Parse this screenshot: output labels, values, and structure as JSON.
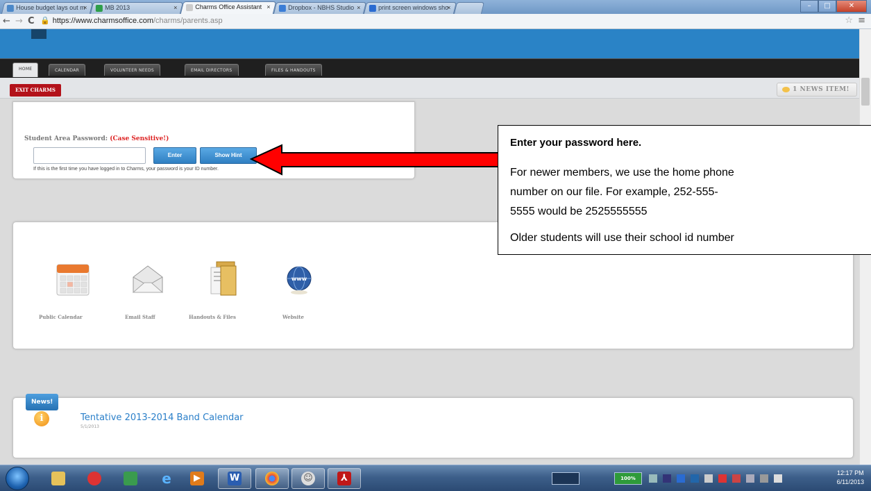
{
  "browser": {
    "tabs": [
      {
        "label": "House budget lays out m",
        "active": false
      },
      {
        "label": "MB 2013",
        "active": false
      },
      {
        "label": "Charms Office Assistant",
        "active": true
      },
      {
        "label": "Dropbox - NBHS Studio",
        "active": false
      },
      {
        "label": "print screen windows sho",
        "active": false
      }
    ],
    "tab_close": "×",
    "back_icon": "←",
    "forward_icon": "→",
    "reload_icon": "C",
    "url_host": "https://www.charmsoffice.com",
    "url_path": "/charms/parents.asp",
    "star_icon": "☆",
    "menu_icon": "≡"
  },
  "site": {
    "nav_tabs": [
      "HOME",
      "CALENDAR",
      "VOLUNTEER NEEDS",
      "EMAIL DIRECTORS",
      "FILES & HANDOUTS"
    ],
    "exit_label": "EXIT CHARMS",
    "news_count_label": "1 NEWS ITEM!",
    "password": {
      "label": "Student Area Password: ",
      "case_note": "(Case Sensitive!)",
      "input_value": "",
      "enter_label": "Enter",
      "hint_label": "Show Hint",
      "first_time_text": "If this is the first time you have logged in to Charms, your password is your ID number."
    },
    "apps": [
      {
        "label": "Public Calendar",
        "icon": "calendar-icon"
      },
      {
        "label": "Email Staff",
        "icon": "envelope-icon"
      },
      {
        "label": "Handouts & Files",
        "icon": "folder-icon"
      },
      {
        "label": "Website",
        "icon": "globe-icon"
      }
    ],
    "news": {
      "badge": "News!",
      "info_icon": "i",
      "item_title": "Tentative 2013-2014 Band Calendar",
      "item_date": "5/1/2013"
    }
  },
  "callout": {
    "title": "Enter your password here.",
    "para1_line1": "For newer members, we use the home phone",
    "para1_line2": "number on our file. For example, 252-555-",
    "para1_line3": "5555 would be 2525555555",
    "para2": "Older students will use their school id number"
  },
  "taskbar": {
    "clock_time": "12:17 PM",
    "clock_date": "6/11/2013",
    "battery": "100%"
  },
  "colors": {
    "site_blue": "#2a83c6",
    "exit_red": "#b3121a",
    "arrow_red": "#ff0000",
    "link_blue": "#2a7fc9"
  }
}
